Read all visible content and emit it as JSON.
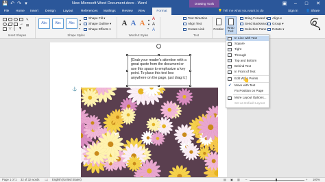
{
  "window": {
    "title": "New Microsoft Word Document.docx - Word",
    "context_tab_group": "Drawing Tools",
    "signin_label": "Sign in",
    "share_label": "Share"
  },
  "tabs": [
    "File",
    "Home",
    "Insert",
    "Design",
    "Layout",
    "References",
    "Mailings",
    "Review",
    "View",
    "Format"
  ],
  "active_tab": "Format",
  "tell_me": "Tell me what you want to do",
  "ribbon": {
    "groups": {
      "insert_shapes": "Insert Shapes",
      "shape_styles": "Shape Styles",
      "wordart_styles": "WordArt Styles",
      "text": "Text"
    },
    "style_samples": [
      "Abc",
      "Abc",
      "Abc"
    ],
    "wordart_samples": [
      "A",
      "A",
      "A"
    ],
    "shape_style_buttons": [
      "Shape Fill",
      "Shape Outline",
      "Shape Effects"
    ],
    "text_buttons": [
      "Text Direction",
      "Align Text",
      "Create Link"
    ],
    "position_label": "Position",
    "wrap_text_label": "Wrap Text",
    "arrange_buttons": [
      "Bring Forward",
      "Send Backward",
      "Selection Pane"
    ],
    "align_buttons": [
      "Align",
      "Group",
      "Rotate"
    ]
  },
  "document": {
    "textbox_text": "[Grab your reader's attention with a great quote from the document or use this space to emphasize a key point. To place this text box anywhere on the page, just drag it.]"
  },
  "wrap_menu": {
    "items": [
      {
        "label": "In Line with Text",
        "state": "selected"
      },
      {
        "label": "Square",
        "state": "normal"
      },
      {
        "label": "Tight",
        "state": "normal"
      },
      {
        "label": "Through",
        "state": "normal"
      },
      {
        "label": "Top and Bottom",
        "state": "normal"
      },
      {
        "label": "Behind Text",
        "state": "normal"
      },
      {
        "label": "In Front of Text",
        "state": "normal"
      },
      {
        "label": "Edit Wrap Points",
        "state": "normal"
      },
      {
        "label": "Move with Text",
        "state": "checked"
      },
      {
        "label": "Fix Position on Page",
        "state": "normal"
      },
      {
        "label": "More Layout Options...",
        "state": "normal"
      },
      {
        "label": "Set as Default Layout",
        "state": "disabled"
      }
    ]
  },
  "status": {
    "page": "Page 1 of 1",
    "words": "32 of 32 words",
    "language": "English (United States)",
    "zoom": "100%"
  },
  "colors": {
    "word_blue": "#2b579a",
    "drawing_tools": "#7a4f9e",
    "selected_item": "#c5d9f1"
  }
}
